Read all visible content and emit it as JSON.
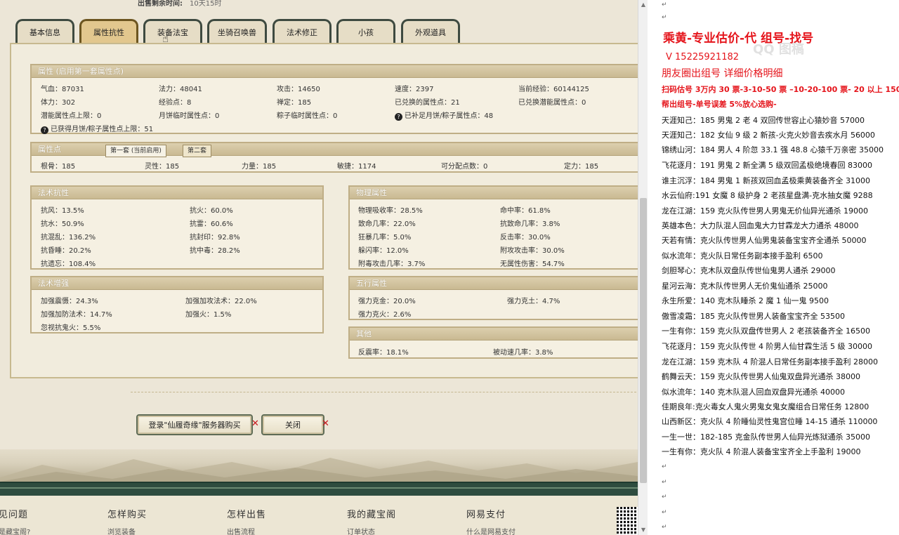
{
  "top": {
    "label": "出售剩余时间:",
    "value": "10天15时"
  },
  "tabs": [
    "基本信息",
    "属性抗性",
    "装备法宝",
    "坐骑召唤兽",
    "法术修正",
    "小孩",
    "外观道具"
  ],
  "attributes": {
    "title": "属性 (启用第一套属性点)",
    "rows": [
      [
        "气血：87031",
        "法力：48041",
        "攻击：14650",
        "速度：2397",
        "当前经验：60144125"
      ],
      [
        "体力：302",
        "经验点：8",
        "禅定：185",
        "已兑换的属性点：21",
        "已兑换潜能属性点：0"
      ],
      [
        "潜能属性点上限：0",
        "月饼临时属性点：0",
        "粽子临时属性点：0",
        "已补足月饼/粽子属性点：48",
        ""
      ]
    ],
    "note": "已获得月饼/粽子属性点上限：51"
  },
  "points": {
    "title": "属性点",
    "subtabs": [
      "第一套 (当前启用)",
      "第二套"
    ],
    "values": [
      "根骨：185",
      "灵性：185",
      "力量：185",
      "敏捷：1174",
      "可分配点数：0",
      "定力：185"
    ]
  },
  "resist": {
    "title": "法术抗性",
    "rows": [
      [
        "抗风：13.5%",
        "抗火：60.0%"
      ],
      [
        "抗水：50.9%",
        "抗雷：60.6%"
      ],
      [
        "抗混乱：136.2%",
        "抗封印：92.8%"
      ],
      [
        "抗昏睡：20.2%",
        "抗中毒：28.2%"
      ],
      [
        "抗遗忘：108.4%",
        ""
      ]
    ]
  },
  "physical": {
    "title": "物理属性",
    "rows": [
      [
        "物理吸收率：28.5%",
        "命中率：61.8%"
      ],
      [
        "致命几率：22.0%",
        "抗致命几率：3.8%"
      ],
      [
        "狂暴几率：5.0%",
        "反击率：30.0%"
      ],
      [
        "躲闪率：12.0%",
        "附攻攻击率：30.0%"
      ],
      [
        "附毒攻击几率：3.7%",
        "无属性伤害：54.7%"
      ]
    ]
  },
  "enhance": {
    "title": "法术增强",
    "rows": [
      [
        "加强震慑：24.3%",
        "加强加攻法术：22.0%"
      ],
      [
        "加强加防法术：14.7%",
        "加强火：1.5%"
      ],
      [
        "忽视抗鬼火：5.5%",
        ""
      ]
    ]
  },
  "wuxing": {
    "title": "五行属性",
    "rows": [
      [
        "强力克金：20.0%",
        "强力克土：4.7%"
      ],
      [
        "强力克火：2.6%",
        ""
      ]
    ]
  },
  "other": {
    "title": "其他",
    "rows": [
      [
        "反震率：18.1%",
        "被动速几率：3.8%"
      ]
    ]
  },
  "buttons": {
    "login": "登录\"仙履奇缘\"服务器购买",
    "close": "关闭"
  },
  "footer": [
    {
      "head": "见问题",
      "link": "是藏宝阁?"
    },
    {
      "head": "怎样购买",
      "link": "浏览装备"
    },
    {
      "head": "怎样出售",
      "link": "出售流程"
    },
    {
      "head": "我的藏宝阁",
      "link": "订单状态"
    },
    {
      "head": "网易支付",
      "link": "什么是网易支付"
    }
  ],
  "doc": {
    "title": "乘黄-专业估价-代 组号-找号",
    "phone": "V 15225921182",
    "moments": "朋友圈出组号   详细价格明细",
    "prices": "扫码估号 3万内 30 票-3-10-50 票 –10-20-100 票- 20 以上 150",
    "guarantee": "帮出组号-单号误差 5%放心选购-",
    "watermark": "QQ 图稿",
    "listings": [
      "天涯知己：185 男鬼 2 老 4 双回传世容止心猿妙音 57000",
      "天涯知己：182 女仙 9 级 2 新孩-火克火妙音去疾水月 56000",
      "锦绣山河：184 男人 4 阶忽 33.1 强 48.8 心猿千万亲密 35000",
      "飞花逐月：191 男鬼 2 新全满 5 级双回孟极绝境春回 83000",
      "谁主沉浮：184 男鬼 1 新孩双回血孟极乘黄装备齐全 31000",
      "水云仙府:191 女魔 8 级护身 2 老孩星盘满-克水抽女魔 9288",
      "龙在江湖：159 克火队传世男人男鬼无价仙异光通杀 19000",
      "英雄本色：大力队混人回血鬼大力甘霖龙大力通杀 48000",
      "天若有情：克火队传世男人仙男鬼装备宝宝齐全通杀 50000",
      "似水流年：克火队日常任务副本接手盈利 6500",
      "剑胆琴心：克木队双盘队传世仙鬼男人通杀 29000",
      "星河云海：克木队传世男人无价鬼仙通杀 25000",
      "永生所爱：140 克木队睡杀 2 魔 1 仙一鬼 9500",
      "傲雪凌霜：185 克火队传世男人装备宝宝齐全 53500",
      "一生有你：159 克火队双盘传世男人 2 老孩装备齐全 16500",
      "飞花逐月：159 克火队传世 4 阶男人仙甘霖生活 5 级 30000",
      "龙在江湖：159 克木队 4 阶混人日常任务副本接手盈利 28000",
      "鹤舞云天：159 克火队传世男人仙鬼双盘异光通杀 38000",
      "似水流年：140 克木队混人回血双盘异光通杀 40000",
      "佳期良年:克火毒女人鬼火男鬼女鬼女魔组合日常任务 12800",
      "山西新区：克火队 4 阶睡仙灵性鬼宫位睡 14-15 通杀 110000",
      "一生一世：182-185 克金队传世男人仙异光炼狱通杀 35000",
      "一生有你：克火队 4 阶混人装备宝宝齐全上手盈利 19000"
    ]
  }
}
